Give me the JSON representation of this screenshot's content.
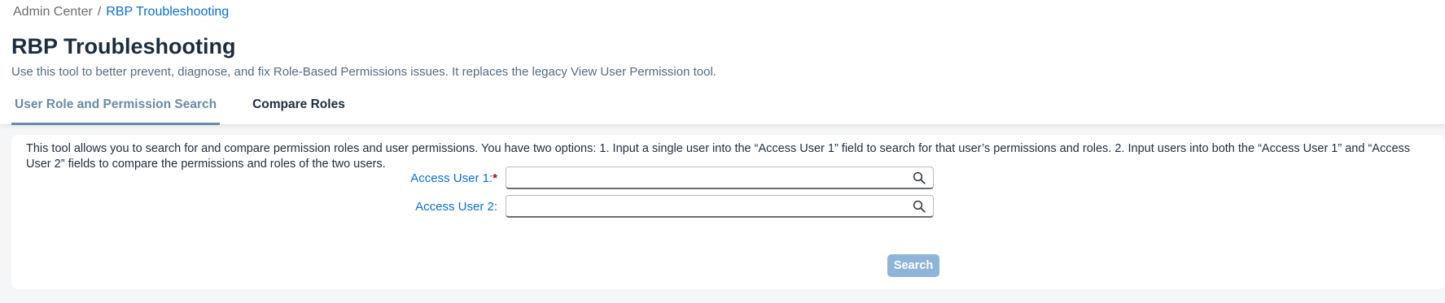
{
  "breadcrumb": {
    "root": "Admin Center",
    "separator": "/",
    "current": "RBP Troubleshooting"
  },
  "page": {
    "title": "RBP Troubleshooting",
    "subtitle": "Use this tool to better prevent, diagnose, and fix Role-Based Permissions issues. It replaces the legacy View User Permission tool."
  },
  "tabs": [
    {
      "label": "User Role and Permission Search",
      "active": true
    },
    {
      "label": "Compare Roles",
      "active": false
    }
  ],
  "card": {
    "info": "This tool allows you to search for and compare permission roles and user permissions. You have two options: 1. Input a single user into the “Access User 1” field to search for that user’s permissions and roles. 2. Input users into both the “Access User 1” and “Access User 2” fields to compare the permissions and roles of the two users.",
    "field1": {
      "label": "Access User 1:",
      "required_marker": "*",
      "value": "",
      "icon": "search-icon"
    },
    "field2": {
      "label": "Access User 2:",
      "value": "",
      "icon": "search-icon"
    },
    "search_label": "Search"
  },
  "colors": {
    "link": "#0a6ed1",
    "active_tab": "#6a8aa8",
    "button_disabled": "#8fb4d9",
    "required": "#bb0000"
  }
}
